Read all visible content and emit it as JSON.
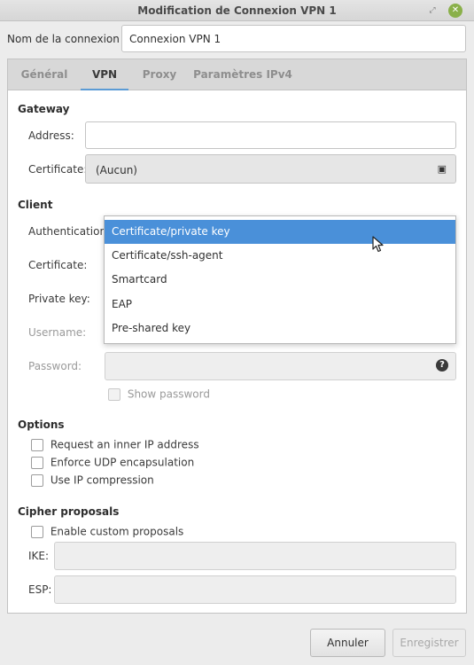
{
  "window": {
    "title": "Modification de Connexion VPN 1"
  },
  "connection": {
    "name_label": "Nom de la connexion :",
    "name_value": "Connexion VPN 1"
  },
  "tabs": [
    {
      "label": "Général"
    },
    {
      "label": "VPN"
    },
    {
      "label": "Proxy"
    },
    {
      "label": "Paramètres IPv4"
    }
  ],
  "gateway": {
    "heading": "Gateway",
    "address_label": "Address:",
    "address_value": "",
    "certificate_label": "Certificate:",
    "certificate_value": "(Aucun)"
  },
  "client": {
    "heading": "Client",
    "authentication_label": "Authentication:",
    "certificate_label": "Certificate:",
    "private_key_label": "Private key:",
    "username_label": "Username:",
    "password_label": "Password:",
    "show_password_label": "Show password",
    "auth_options": [
      "Certificate/private key",
      "Certificate/ssh-agent",
      "Smartcard",
      "EAP",
      "Pre-shared key"
    ]
  },
  "options": {
    "heading": "Options",
    "inner_ip": "Request an inner IP address",
    "udp_encap": "Enforce UDP encapsulation",
    "ip_compression": "Use IP compression"
  },
  "cipher": {
    "heading": "Cipher proposals",
    "enable_custom": "Enable custom proposals",
    "ike_label": "IKE:",
    "esp_label": "ESP:"
  },
  "footer": {
    "cancel_label": "Annuler",
    "save_label": "Enregistrer"
  },
  "colors": {
    "accent": "#4a90d9",
    "close_button": "#8ab04a"
  }
}
